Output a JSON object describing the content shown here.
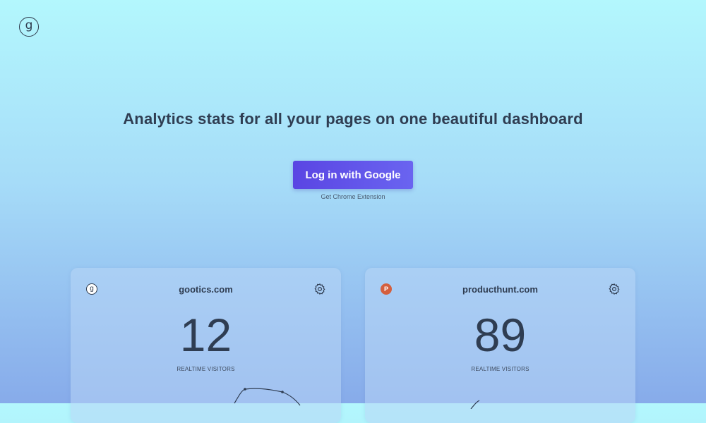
{
  "header": {
    "logo_glyph": "g"
  },
  "hero": {
    "headline": "Analytics stats for all your pages on one beautiful dashboard",
    "login_label": "Log in with Google",
    "extension_label": "Get Chrome Extension"
  },
  "cards": [
    {
      "icon_glyph": "g",
      "site": "gootics.com",
      "visitors": "12",
      "visitors_label": "REALTIME VISITORS"
    },
    {
      "icon_glyph": "P",
      "site": "producthunt.com",
      "visitors": "89",
      "visitors_label": "REALTIME VISITORS"
    }
  ],
  "colors": {
    "button_start": "#5a45e3",
    "button_end": "#6a64f0",
    "producthunt_brand": "#d45f3e",
    "text_dark": "#2f3d52"
  },
  "icons": {
    "logo": "gootics-logo-icon",
    "settings": "gear-icon"
  }
}
